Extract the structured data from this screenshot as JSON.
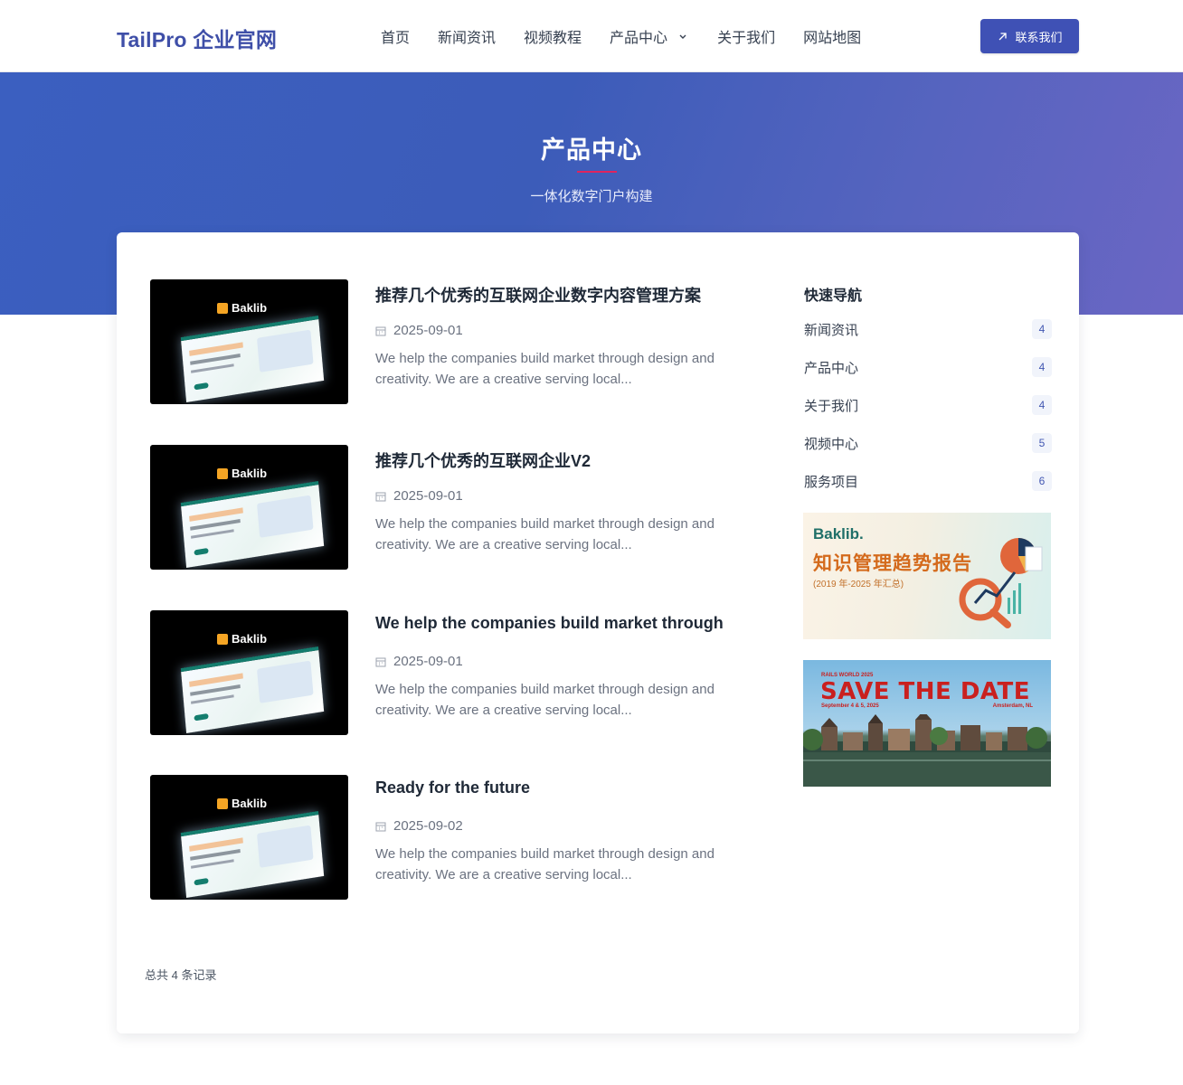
{
  "header": {
    "logo": "TailPro 企业官网",
    "nav": [
      {
        "label": "首页"
      },
      {
        "label": "新闻资讯"
      },
      {
        "label": "视频教程"
      },
      {
        "label": "产品中心"
      },
      {
        "label": "关于我们"
      },
      {
        "label": "网站地图"
      }
    ],
    "contact_label": "联系我们"
  },
  "hero": {
    "title": "产品中心",
    "subtitle": "一体化数字门户构建"
  },
  "posts": [
    {
      "title": "推荐几个优秀的互联网企业数字内容管理方案",
      "date": "2025-09-01",
      "excerpt": "We help the companies build market through design and creativity. We are a creative serving local...",
      "thumb_brand": "Baklib"
    },
    {
      "title": "推荐几个优秀的互联网企业V2",
      "date": "2025-09-01",
      "excerpt": "We help the companies build market through design and creativity. We are a creative serving local...",
      "thumb_brand": "Baklib"
    },
    {
      "title": "We help the companies build market through",
      "date": "2025-09-01",
      "excerpt": "We help the companies build market through design and creativity. We are a creative serving local...",
      "thumb_brand": "Baklib"
    },
    {
      "title": "Ready for the future",
      "date": "2025-09-02",
      "excerpt": "We help the companies build market through design and creativity. We are a creative serving local...",
      "thumb_brand": "Baklib"
    }
  ],
  "total": "总共 4 条记录",
  "sidebar": {
    "title": "快速导航",
    "items": [
      {
        "label": "新闻资讯",
        "count": "4"
      },
      {
        "label": "产品中心",
        "count": "4"
      },
      {
        "label": "关于我们",
        "count": "4"
      },
      {
        "label": "视频中心",
        "count": "5"
      },
      {
        "label": "服务项目",
        "count": "6"
      }
    ],
    "banner1": {
      "brand": "Baklib.",
      "title": "知识管理趋势报告",
      "subtitle": "(2019 年-2025 年汇总)"
    },
    "banner2": {
      "small": "RAILS WORLD 2025",
      "big": "SAVE THE DATE",
      "date": "September 4 & 5, 2025",
      "location": "Amsterdam, NL"
    }
  },
  "colors": {
    "primary": "#3f51b5",
    "hero_start": "#3b5fc0",
    "hero_end": "#6b66c4",
    "accent_line": "#e0245e"
  }
}
